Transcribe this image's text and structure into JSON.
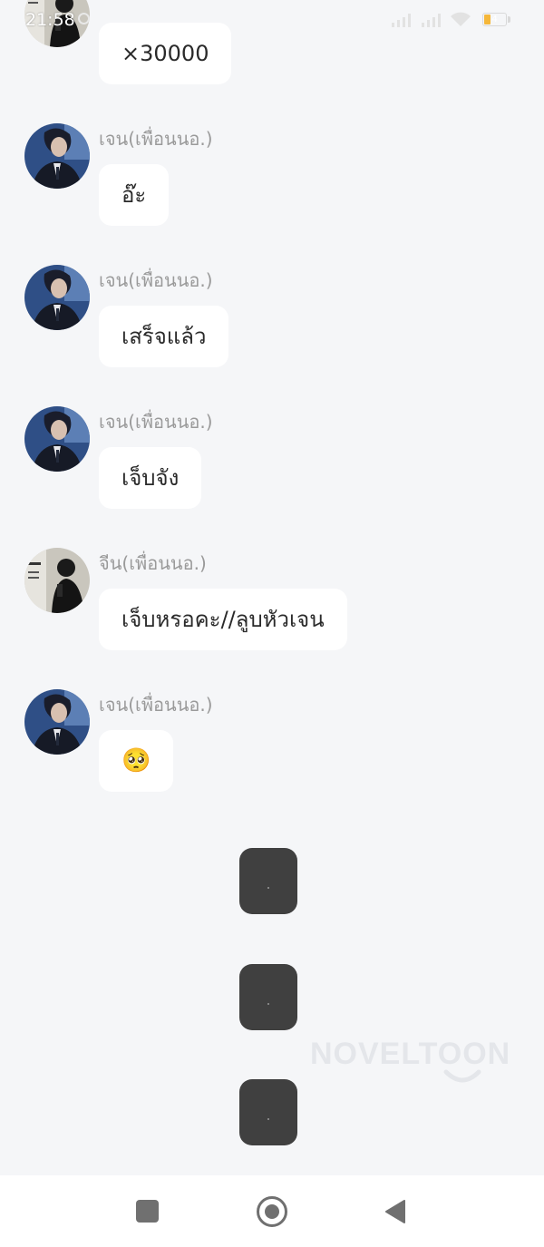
{
  "status_bar": {
    "time": "21:58",
    "battery_level": "4",
    "icons": [
      "clock-icon",
      "signal-icon",
      "signal-icon",
      "wifi-icon",
      "battery-icon"
    ]
  },
  "messages": [
    {
      "sender": "",
      "text": "×30000",
      "avatar": "avatar-jin"
    },
    {
      "sender": "เจน(เพื่อนนอ.)",
      "text": "อ๊ะ",
      "avatar": "avatar-jen"
    },
    {
      "sender": "เจน(เพื่อนนอ.)",
      "text": "เสร็จแล้ว",
      "avatar": "avatar-jen"
    },
    {
      "sender": "เจน(เพื่อนนอ.)",
      "text": "เจ็บจัง",
      "avatar": "avatar-jen"
    },
    {
      "sender": "จีน(เพื่อนนอ.)",
      "text": "เจ็บหรอคะ//ลูบหัวเจน",
      "avatar": "avatar-jin"
    },
    {
      "sender": "เจน(เพื่อนนอ.)",
      "text": "🥺",
      "avatar": "avatar-jen"
    }
  ],
  "loaders": [
    "loading-indicator",
    "loading-indicator",
    "loading-indicator"
  ],
  "watermark": "NOVELTOON",
  "nav_bar": {
    "icons": [
      "recents-icon",
      "home-icon",
      "back-icon"
    ]
  },
  "colors": {
    "background": "#f5f6f8",
    "bubble": "#ffffff",
    "sender_name": "#9a9a9a",
    "loader": "#404040",
    "nav_icon": "#707070",
    "battery": "#f5b73a"
  }
}
